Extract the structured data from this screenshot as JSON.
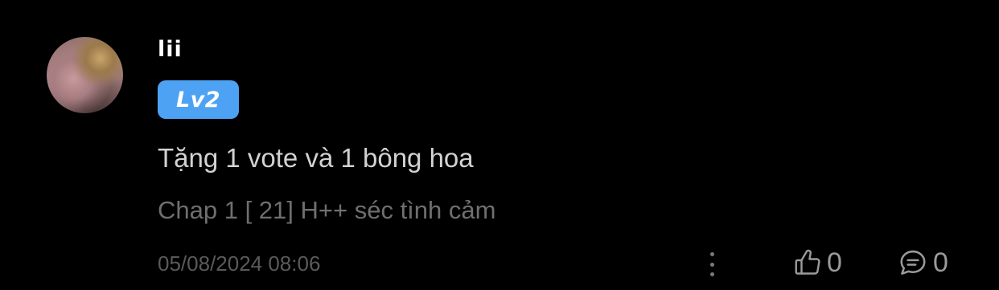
{
  "comment": {
    "username": "lii",
    "level": "Lv2",
    "text": "Tặng 1 vote và 1 bông hoa",
    "chapter": "Chap 1 [ 21] H++ séc tình cảm",
    "timestamp": "05/08/2024 08:06",
    "likes": "0",
    "replies": "0"
  },
  "icons": {
    "more": "more-vertical-icon",
    "like": "thumbs-up-icon",
    "reply": "comment-bubble-icon"
  },
  "colors": {
    "background": "#000000",
    "badge": "#4ea2f3",
    "text_primary": "#d2d2d2",
    "text_secondary": "#6f6f6f",
    "icon": "#9a9a9a"
  }
}
